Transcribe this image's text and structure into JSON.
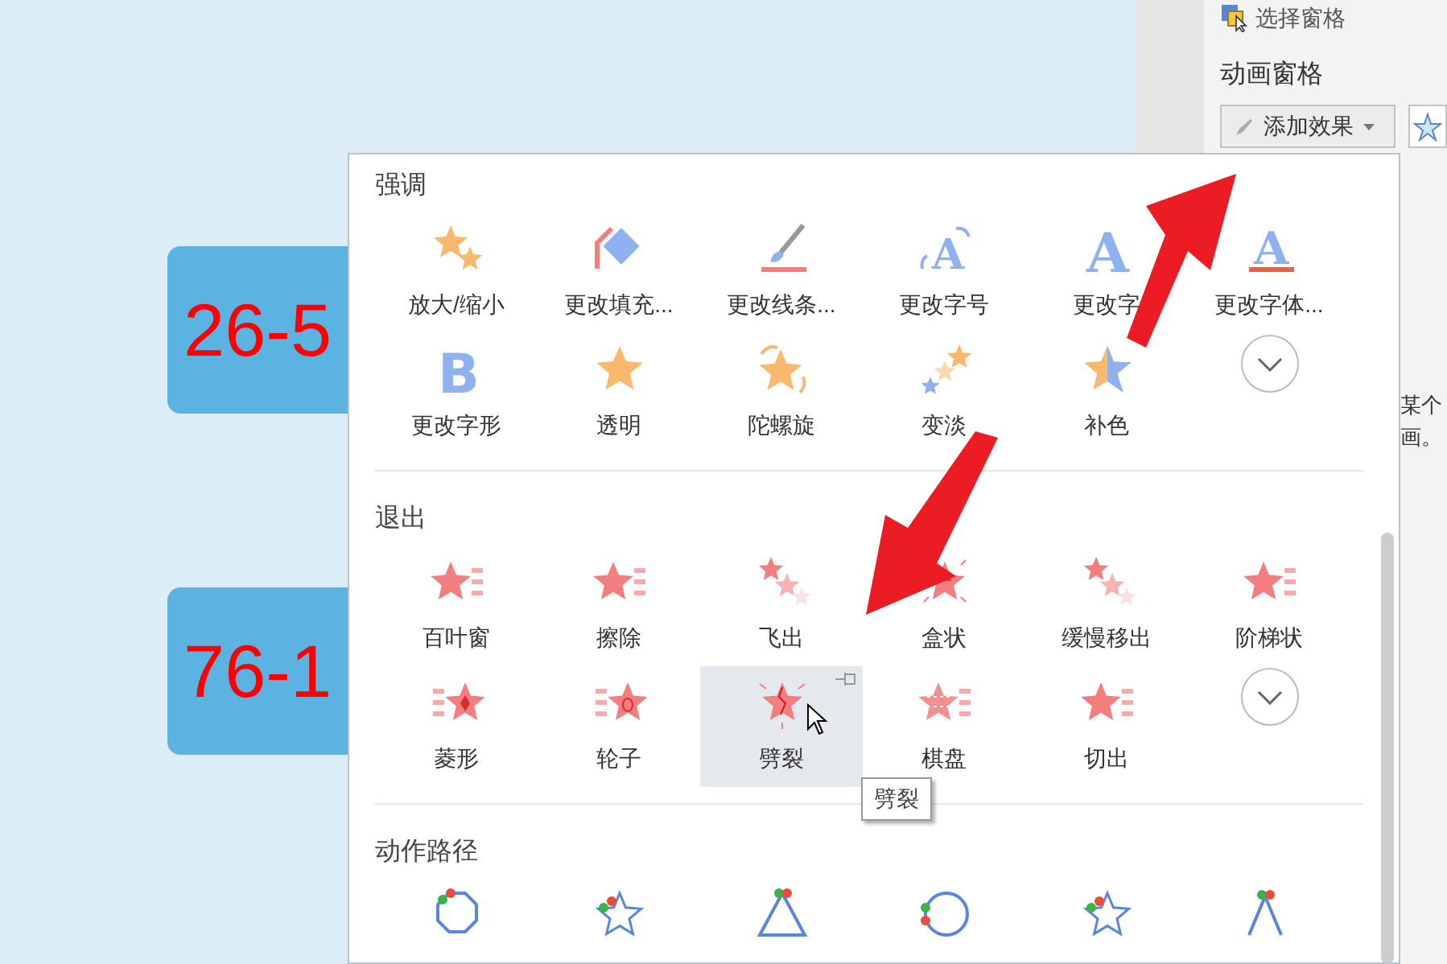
{
  "slide": {
    "boxes": [
      {
        "text": "26-5"
      },
      {
        "text": "76-1"
      }
    ]
  },
  "right_panel": {
    "selection_pane": "选择窗格",
    "title": "动画窗格",
    "add_effect_button": "添加效果",
    "description_lines": [
      "某个",
      "画。"
    ]
  },
  "effect_menu": {
    "sections": [
      {
        "title": "强调",
        "items": [
          {
            "label": "放大/缩小",
            "kind": "grow",
            "selected": false
          },
          {
            "label": "更改填充...",
            "kind": "fill",
            "selected": false
          },
          {
            "label": "更改线条...",
            "kind": "line",
            "selected": false
          },
          {
            "label": "更改字号",
            "kind": "fontsize",
            "glyph": "A",
            "selected": false
          },
          {
            "label": "更改字",
            "kind": "letter",
            "glyph": "A",
            "selected": false
          },
          {
            "label": "更改字体...",
            "kind": "underline",
            "glyph": "A",
            "selected": false
          },
          {
            "label": "更改字形",
            "kind": "bold",
            "glyph": "B",
            "selected": false
          },
          {
            "label": "透明",
            "kind": "star",
            "selected": false
          },
          {
            "label": "陀螺旋",
            "kind": "spin",
            "selected": false
          },
          {
            "label": "变淡",
            "kind": "fade",
            "selected": false
          },
          {
            "label": "补色",
            "kind": "complement",
            "selected": false
          }
        ],
        "more": true
      },
      {
        "title": "退出",
        "items": [
          {
            "label": "百叶窗",
            "kind": "exit",
            "selected": false
          },
          {
            "label": "擦除",
            "kind": "exit",
            "selected": false
          },
          {
            "label": "飞出",
            "kind": "fly",
            "selected": false
          },
          {
            "label": "盒状",
            "kind": "box",
            "selected": false
          },
          {
            "label": "缓慢移出",
            "kind": "fly",
            "selected": false
          },
          {
            "label": "阶梯状",
            "kind": "exit",
            "selected": false
          },
          {
            "label": "菱形",
            "kind": "diamond",
            "selected": false
          },
          {
            "label": "轮子",
            "kind": "wheel",
            "selected": false
          },
          {
            "label": "劈裂",
            "kind": "split",
            "selected": true
          },
          {
            "label": "棋盘",
            "kind": "checker",
            "selected": false
          },
          {
            "label": "切出",
            "kind": "exit",
            "selected": false
          }
        ],
        "more": true
      },
      {
        "title": "动作路径",
        "items": [
          {
            "kind": "octagon",
            "selected": false
          },
          {
            "kind": "starpath",
            "selected": false
          },
          {
            "kind": "triangle",
            "selected": false
          },
          {
            "kind": "circle",
            "selected": false
          },
          {
            "kind": "starpath",
            "selected": false
          },
          {
            "kind": "arc",
            "selected": false
          }
        ]
      }
    ]
  },
  "tooltip": "劈裂"
}
